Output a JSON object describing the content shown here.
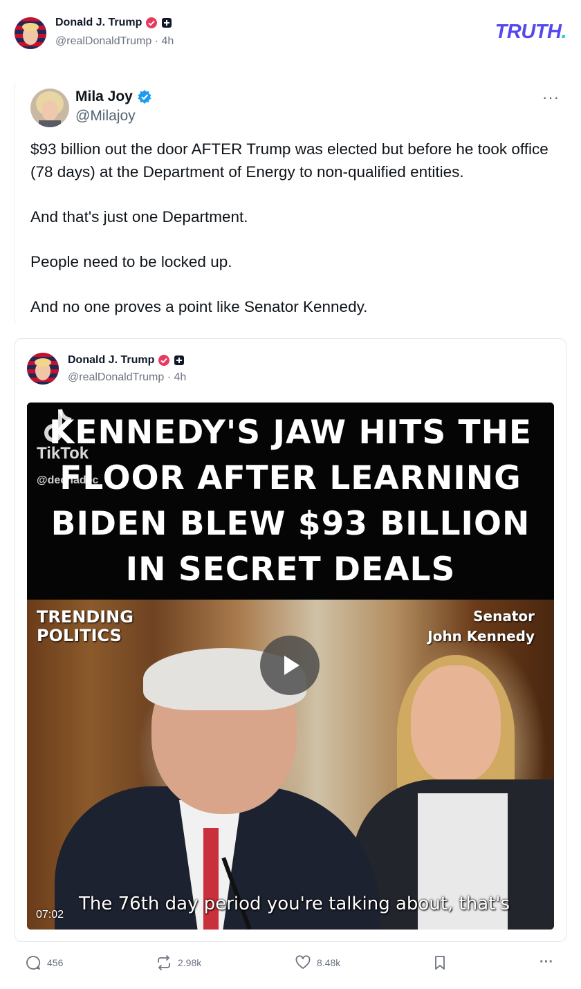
{
  "header": {
    "author_name": "Donald J. Trump",
    "handle": "@realDonaldTrump",
    "time": "4h",
    "brand": "TRUTH",
    "brand_dot": ".",
    "brand_color": "#5448ee"
  },
  "quoted_x_post": {
    "name": "Mila Joy",
    "handle": "@Milajoy",
    "more_label": "···",
    "paragraphs": [
      "$93 billion out the door AFTER Trump was elected but before he took office (78 days) at the Department of Energy to non-qualified entities.",
      "And that's just one Department.",
      "People need to be locked up.",
      "And no one proves a point like Senator Kennedy."
    ]
  },
  "quoted_truth": {
    "author_name": "Donald J. Trump",
    "handle": "@realDonaldTrump",
    "time": "4h",
    "video": {
      "headline": "KENNEDY'S JAW HITS THE FLOOR AFTER LEARNING BIDEN BLEW $93 BILLION IN SECRET DEALS",
      "watermark": "TikTok",
      "watermark_handle": "@dechadec",
      "trend_line1": "TRENDING",
      "trend_line2": "POLITICS",
      "senator_line1": "Senator",
      "senator_line2": "John Kennedy",
      "caption": "The 76th day period you're talking about, that's",
      "duration": "07:02"
    }
  },
  "actions": {
    "replies": "456",
    "retruths": "2.98k",
    "likes": "8.48k",
    "more_label": "···"
  },
  "colors": {
    "verified_pink": "#e8395f",
    "verified_blue": "#1d9bf0",
    "muted_text": "#6b7280"
  },
  "icons": [
    "verified-badge-icon",
    "plus-badge-icon",
    "more-icon",
    "play-icon",
    "reply-icon",
    "retruth-icon",
    "like-icon",
    "bookmark-icon"
  ]
}
